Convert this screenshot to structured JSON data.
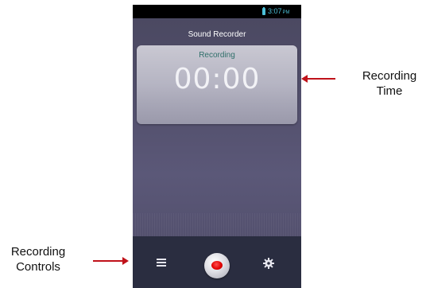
{
  "status_bar": {
    "time": "3:07",
    "ampm": "PM",
    "battery_icon": "battery-icon",
    "accent_color": "#4cc0d8"
  },
  "app": {
    "title": "Sound Recorder"
  },
  "recording_card": {
    "status": "Recording",
    "time": "00:00"
  },
  "controls": {
    "menu_icon": "menu-icon",
    "record_icon": "record-icon",
    "settings_icon": "gear-icon",
    "record_color": "#e00000"
  },
  "annotations": {
    "time_label_line1": "Recording",
    "time_label_line2": "Time",
    "controls_label_line1": "Recording",
    "controls_label_line2": "Controls",
    "arrow_color": "#c0121a"
  }
}
